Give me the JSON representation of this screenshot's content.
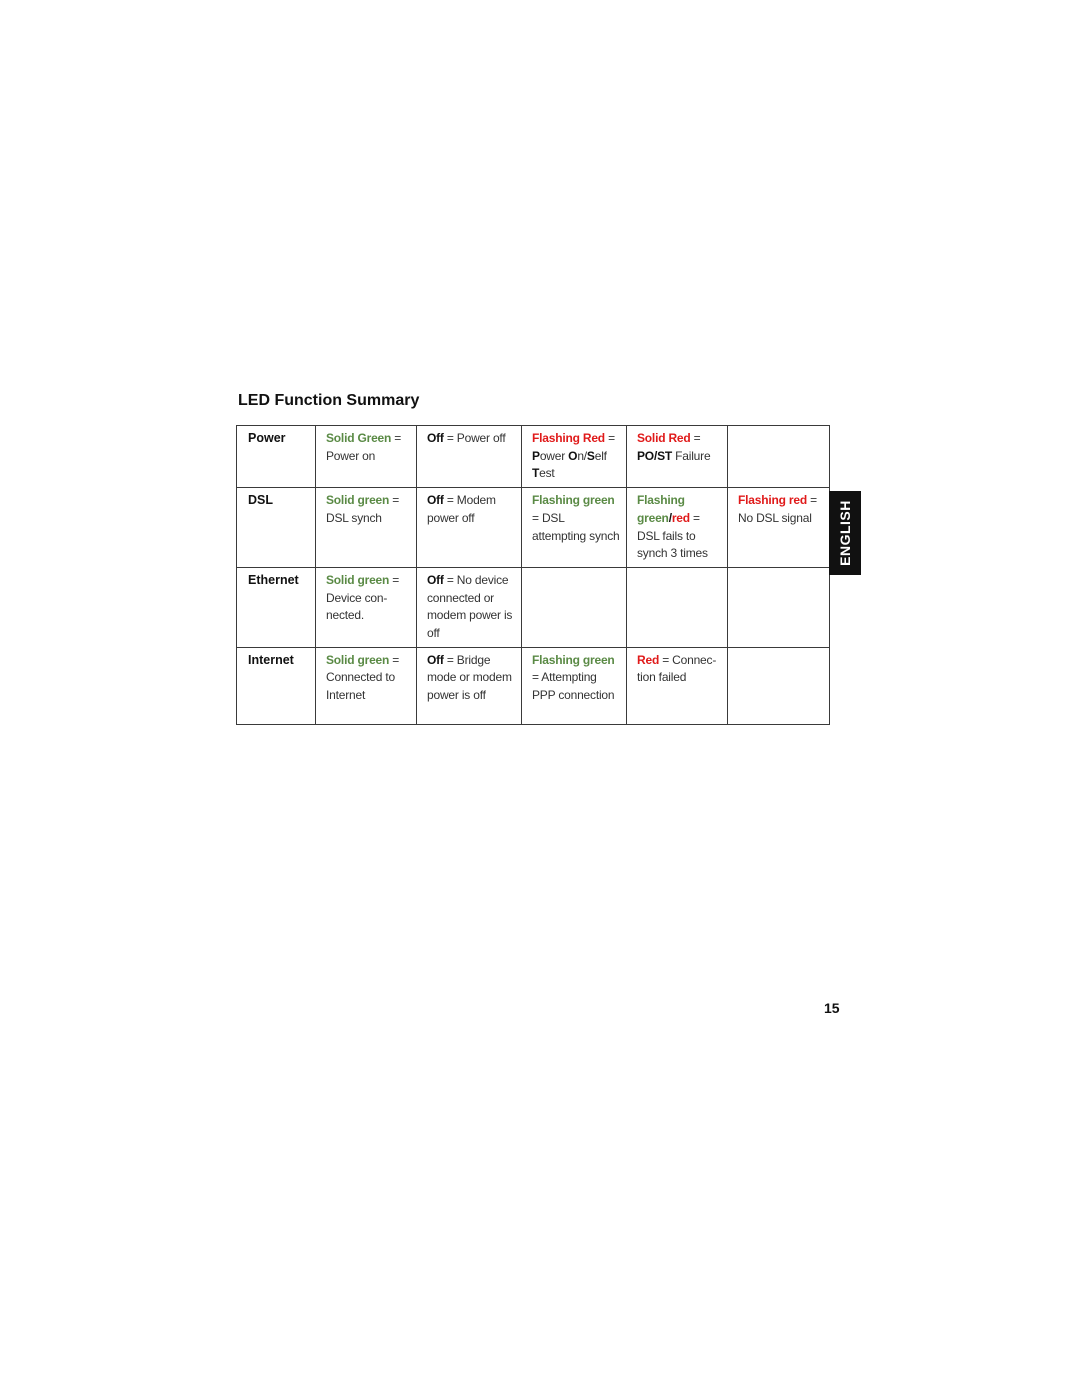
{
  "document": {
    "title": "LED Function Summary",
    "page_number": "15",
    "side_tab": "ENGLISH"
  },
  "colors": {
    "green": "#5a8a45",
    "red": "#e01a1a",
    "tab_background": "#111111"
  },
  "table": {
    "rows": [
      {
        "label": "Power",
        "cells": [
          [
            {
              "t": "Solid Green",
              "s": "g"
            },
            {
              "t": " = Power on",
              "s": "txt"
            }
          ],
          [
            {
              "t": "Off",
              "s": "b"
            },
            {
              "t": " = Power off",
              "s": "txt"
            }
          ],
          [
            {
              "t": "Flashing Red",
              "s": "r"
            },
            {
              "t": " = ",
              "s": "txt"
            },
            {
              "t": "P",
              "s": "b"
            },
            {
              "t": "ower ",
              "s": "txt"
            },
            {
              "t": "O",
              "s": "b"
            },
            {
              "t": "n/",
              "s": "txt"
            },
            {
              "t": "S",
              "s": "b"
            },
            {
              "t": "elf ",
              "s": "txt"
            },
            {
              "t": "T",
              "s": "b"
            },
            {
              "t": "est",
              "s": "txt"
            }
          ],
          [
            {
              "t": "Solid Red",
              "s": "r"
            },
            {
              "t": " = ",
              "s": "txt"
            },
            {
              "t": "PO/ST",
              "s": "b"
            },
            {
              "t": " Failure",
              "s": "txt"
            }
          ],
          []
        ]
      },
      {
        "label": "DSL",
        "cells": [
          [
            {
              "t": "Solid green",
              "s": "g"
            },
            {
              "t": " = DSL synch",
              "s": "txt"
            }
          ],
          [
            {
              "t": "Off",
              "s": "b"
            },
            {
              "t": " = Modem power off",
              "s": "txt"
            }
          ],
          [
            {
              "t": "Flashing green",
              "s": "g"
            },
            {
              "t": " = DSL attempting synch",
              "s": "txt"
            }
          ],
          [
            {
              "t": "Flashing green",
              "s": "g"
            },
            {
              "t": "/",
              "s": "b"
            },
            {
              "t": "red",
              "s": "r"
            },
            {
              "t": " = DSL fails to synch 3 times",
              "s": "txt"
            }
          ],
          [
            {
              "t": "Flashing red",
              "s": "r"
            },
            {
              "t": " = No DSL signal",
              "s": "txt"
            }
          ]
        ]
      },
      {
        "label": "Ethernet",
        "cells": [
          [
            {
              "t": "Solid green",
              "s": "g"
            },
            {
              "t": " = Device con-nected.",
              "s": "txt"
            }
          ],
          [
            {
              "t": "Off",
              "s": "b"
            },
            {
              "t": " = No device connected or modem power is off",
              "s": "txt"
            }
          ],
          [],
          [],
          []
        ]
      },
      {
        "label": "Internet",
        "cells": [
          [
            {
              "t": "Solid green",
              "s": "g"
            },
            {
              "t": " = Connected to Internet",
              "s": "txt"
            }
          ],
          [
            {
              "t": "Off",
              "s": "b"
            },
            {
              "t": " = Bridge mode or modem power is off",
              "s": "txt"
            }
          ],
          [
            {
              "t": "Flashing green",
              "s": "g"
            },
            {
              "t": " = Attempting PPP connection",
              "s": "txt"
            }
          ],
          [
            {
              "t": "Red",
              "s": "r"
            },
            {
              "t": " = Connec-tion failed",
              "s": "txt"
            }
          ],
          []
        ]
      }
    ]
  }
}
